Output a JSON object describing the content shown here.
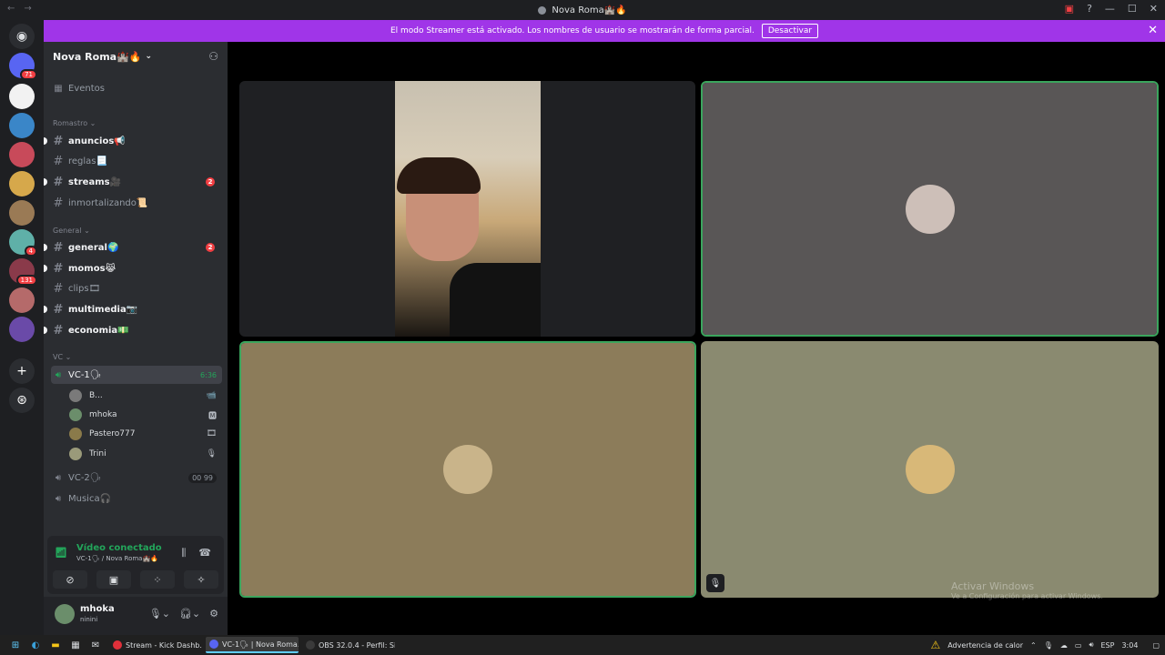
{
  "window": {
    "title": "Nova Roma🏰🔥"
  },
  "banner": {
    "message": "El modo Streamer está activado. Los nombres de usuario se mostrarán de forma parcial.",
    "button": "Desactivar"
  },
  "servers": [
    {
      "badge": "71",
      "color": "#5865f2"
    },
    {
      "badge": "",
      "color": "#f2f2f2"
    },
    {
      "badge": "",
      "color": "#3a86c8"
    },
    {
      "badge": "",
      "color": "#c84a5a"
    },
    {
      "badge": "",
      "color": "#d6a84b"
    },
    {
      "badge": "",
      "color": "#9a7a55"
    },
    {
      "badge": "4",
      "color": "#5fb0a8"
    },
    {
      "badge": "131",
      "color": "#8a3a4a"
    },
    {
      "badge": "",
      "color": "#b56a6a"
    },
    {
      "badge": "",
      "color": "#6a4aa8"
    }
  ],
  "guild": {
    "name": "Nova Roma🏰🔥"
  },
  "events_label": "Eventos",
  "categories": {
    "romastro": "Romastro ⌄",
    "general": "General ⌄",
    "vc": "VC ⌄"
  },
  "channels": [
    {
      "name": "anuncios📢",
      "unread": true,
      "mention": ""
    },
    {
      "name": "reglas📃",
      "unread": false,
      "mention": ""
    },
    {
      "name": "streams🎥",
      "unread": true,
      "mention": "2"
    },
    {
      "name": "inmortalizando📜",
      "unread": false,
      "mention": ""
    },
    {
      "name": "general🌍",
      "unread": true,
      "mention": "2"
    },
    {
      "name": "momos😹",
      "unread": true,
      "mention": ""
    },
    {
      "name": "clips🎞",
      "unread": false,
      "mention": ""
    },
    {
      "name": "multimedia📷",
      "unread": true,
      "mention": ""
    },
    {
      "name": "economia💵",
      "unread": true,
      "mention": ""
    }
  ],
  "voice_channels": {
    "vc1": {
      "name": "VC-1🗣",
      "time": "6:36"
    },
    "vc2": {
      "name": "VC-2🗣",
      "badge": "00 99"
    },
    "musica": {
      "name": "Musica🎧"
    }
  },
  "members": [
    {
      "name": "B...",
      "color": "#7a7a7a",
      "icon": "📹"
    },
    {
      "name": "mhoka",
      "color": "#6b8e6b",
      "icon": "🅼"
    },
    {
      "name": "Pastero777",
      "color": "#8a7a4a",
      "icon": "🎞"
    },
    {
      "name": "Trini",
      "color": "#9a9a7a",
      "icon": "🎙"
    }
  ],
  "voice_panel": {
    "status": "Vídeo conectado",
    "location": "VC-1🗣 / Nova Roma🏰🔥"
  },
  "user": {
    "name": "mhoka",
    "status": "ninini"
  },
  "tiles": [
    {
      "type": "video",
      "bg": "#1f2023",
      "speaking": false
    },
    {
      "type": "avatar",
      "bg": "#595656",
      "avatar": "#cdbfb8",
      "speaking": true
    },
    {
      "type": "avatar",
      "bg": "#8c7c5a",
      "avatar": "#c9b48a",
      "speaking": true
    },
    {
      "type": "avatar",
      "bg": "#8a8a70",
      "avatar": "#d8b878",
      "speaking": false,
      "muted": true
    }
  ],
  "watermark": {
    "title": "Activar Windows",
    "subtitle": "Ve a Configuración para activar Windows."
  },
  "taskbar": {
    "apps": [
      {
        "label": "Stream - Kick Dashb...",
        "color": "#e0303a",
        "active": false
      },
      {
        "label": "VC-1🗣 | Nova Roma...",
        "color": "#5865f2",
        "active": true
      },
      {
        "label": "OBS 32.0.4 - Perfil: Si...",
        "color": "#3a3a3a",
        "active": false
      }
    ],
    "warning": "Advertencia de calor",
    "lang": "ESP",
    "time": "3:04"
  }
}
